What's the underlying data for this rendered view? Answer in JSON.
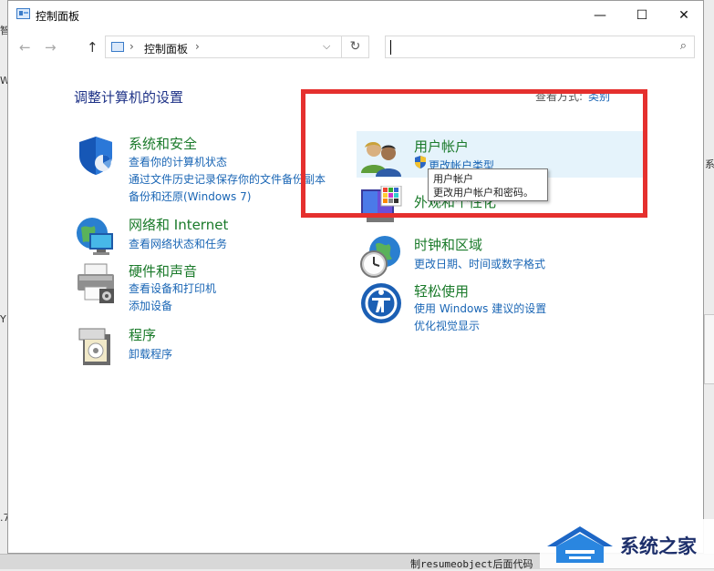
{
  "window": {
    "title": "控制面板"
  },
  "title_buttons": {
    "minimize": "—",
    "maximize": "☐",
    "close": "✕"
  },
  "nav": {
    "back": "←",
    "forward": "→",
    "up": "↑",
    "address_sep": "›",
    "address": "控制面板",
    "address_sep2": "›",
    "dropdown": "⌵",
    "refresh": "↻",
    "search_value": "",
    "search_icon": "⌕"
  },
  "content": {
    "heading": "调整计算机的设置",
    "view_by_label": "查看方式:",
    "view_by_value": "类别"
  },
  "categories_left": [
    {
      "title": "系统和安全",
      "links": [
        "查看你的计算机状态",
        "通过文件历史记录保存你的文件备份副本",
        "备份和还原(Windows 7)"
      ],
      "icon": "shield-icon"
    },
    {
      "title": "网络和 Internet",
      "links": [
        "查看网络状态和任务"
      ],
      "icon": "network-icon"
    },
    {
      "title": "硬件和声音",
      "links": [
        "查看设备和打印机",
        "添加设备"
      ],
      "icon": "printer-icon"
    },
    {
      "title": "程序",
      "links": [
        "卸载程序"
      ],
      "icon": "programs-icon"
    }
  ],
  "categories_right": [
    {
      "title": "用户帐户",
      "links": [
        "更改帐户类型"
      ],
      "icon": "users-icon"
    },
    {
      "title": "外观和个性化",
      "links": [],
      "icon": "appearance-icon"
    },
    {
      "title": "时钟和区域",
      "links": [
        "更改日期、时间或数字格式"
      ],
      "icon": "clock-globe-icon"
    },
    {
      "title": "轻松使用",
      "links": [
        "使用 Windows 建议的设置",
        "优化视觉显示"
      ],
      "icon": "ease-of-access-icon"
    }
  ],
  "tooltip": {
    "line1": "用户帐户",
    "line2": "更改用户帐户和密码。"
  },
  "watermark": {
    "text": "系统之家"
  },
  "background": {
    "bottom_text": "制resumeobject后面代码"
  },
  "colors": {
    "accent_red": "#e5302e",
    "category_green": "#1a7a2a",
    "link_blue": "#1a66b5",
    "heading_blue": "#1e3287"
  }
}
